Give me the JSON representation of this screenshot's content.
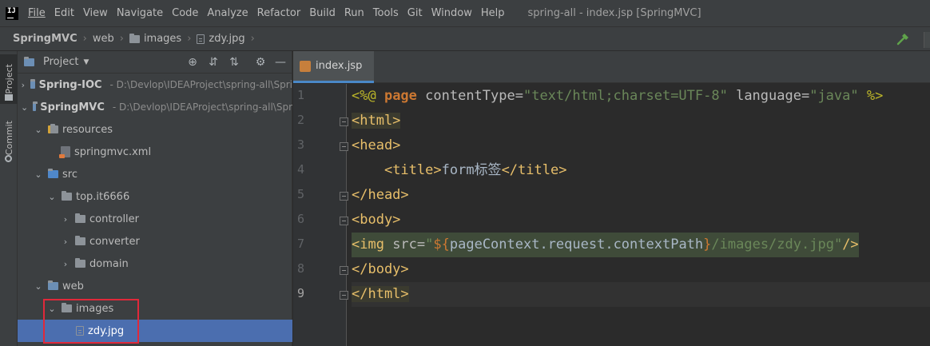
{
  "menubar": {
    "logo": "IJ",
    "items": [
      "File",
      "Edit",
      "View",
      "Navigate",
      "Code",
      "Analyze",
      "Refactor",
      "Build",
      "Run",
      "Tools",
      "Git",
      "Window",
      "Help"
    ],
    "window_title": "spring-all - index.jsp [SpringMVC]"
  },
  "breadcrumb": [
    "SpringMVC",
    "web",
    "images",
    "zdy.jpg"
  ],
  "tool_strip": {
    "project_tab": "Project",
    "commit_tab": "Commit"
  },
  "project_panel": {
    "title": "Project",
    "tree": [
      {
        "label": "Spring-IOC",
        "path": "- D:\\Devlop\\IDEAProject\\spring-all\\Spri",
        "bold": true
      },
      {
        "label": "SpringMVC",
        "path": "- D:\\Devlop\\IDEAProject\\spring-all\\Spr",
        "bold": true
      },
      {
        "label": "resources"
      },
      {
        "label": "springmvc.xml"
      },
      {
        "label": "src"
      },
      {
        "label": "top.it6666"
      },
      {
        "label": "controller"
      },
      {
        "label": "converter"
      },
      {
        "label": "domain"
      },
      {
        "label": "web"
      },
      {
        "label": "images"
      },
      {
        "label": "zdy.jpg"
      }
    ]
  },
  "editor": {
    "tab_label": "index.jsp",
    "line_numbers": [
      "1",
      "2",
      "3",
      "4",
      "5",
      "6",
      "7",
      "8",
      "9"
    ],
    "current_line": 9,
    "code": {
      "l1": {
        "open": "<%@ ",
        "dir": "page",
        "a1": " contentType=",
        "v1": "\"text/html;charset=UTF-8\"",
        "a2": " language=",
        "v2": "\"java\"",
        "close": " %>"
      },
      "l2": {
        "tag": "<html>"
      },
      "l3": {
        "tag": "<head>"
      },
      "l4": {
        "indent": "    ",
        "open": "<title>",
        "text": "form标签",
        "close": "</title>"
      },
      "l5": {
        "tag": "</head>"
      },
      "l6": {
        "tag": "<body>"
      },
      "l7": {
        "open": "<img",
        "a1": " src=",
        "q1": "\"",
        "b1": "${",
        "expr": "pageContext.request.contextPath",
        "b2": "}",
        "rest": "/images/zdy.jpg",
        "q2": "\"",
        "close": "/>"
      },
      "l8": {
        "tag": "</body>"
      },
      "l9": {
        "tag": "</html>"
      }
    }
  },
  "colors": {
    "background": "#2b2b2b",
    "panel": "#3c3f41",
    "selection": "#4b6eaf",
    "highlight_box": "#e0293a",
    "tag": "#e8bf6a",
    "string": "#6a8759"
  }
}
